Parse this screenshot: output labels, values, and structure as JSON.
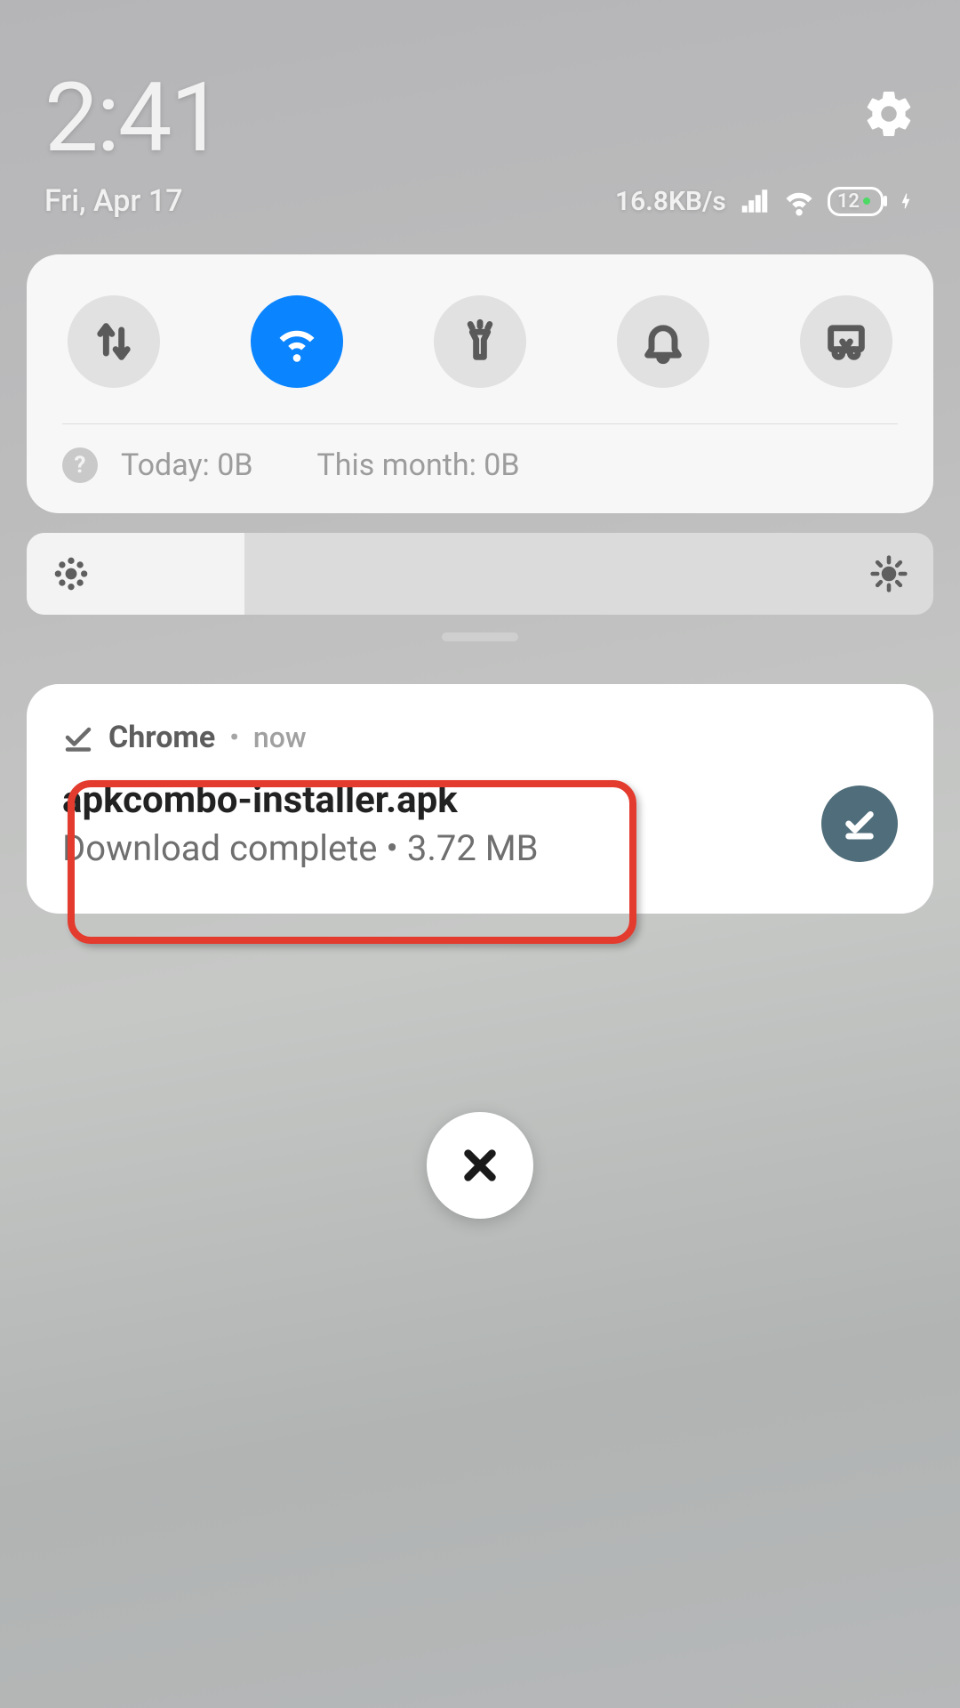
{
  "status": {
    "time": "2:41",
    "date": "Fri, Apr 17",
    "net_speed": "16.8KB/s",
    "battery_level": "12"
  },
  "quick_settings": {
    "toggles": [
      {
        "name": "mobile-data",
        "active": false
      },
      {
        "name": "wifi",
        "active": true
      },
      {
        "name": "flashlight",
        "active": false
      },
      {
        "name": "dnd",
        "active": false
      },
      {
        "name": "screenshot",
        "active": false
      }
    ],
    "data_today": "Today: 0B",
    "data_month": "This month: 0B"
  },
  "brightness": {
    "level_pct": 24
  },
  "notification": {
    "app": "Chrome",
    "when": "now",
    "title": "apkcombo-installer.apk",
    "subtitle": "Download complete • 3.72 MB"
  }
}
